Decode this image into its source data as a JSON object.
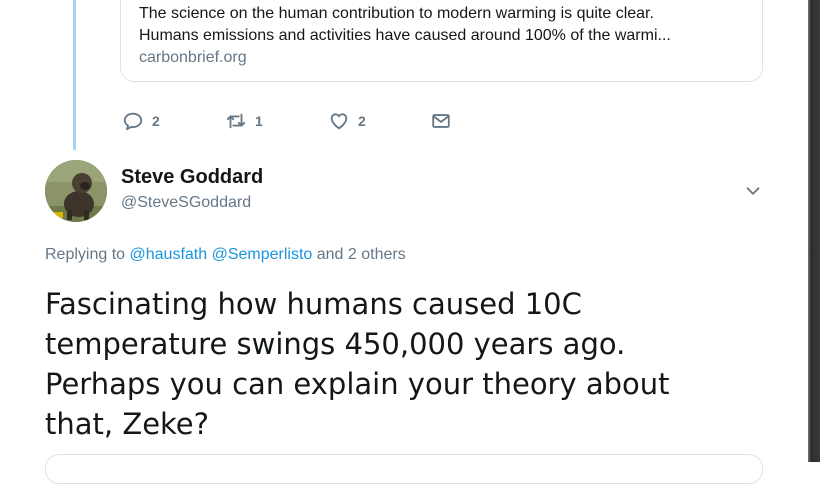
{
  "quoted_tweet": {
    "card": {
      "lines": [
        "The science on the human contribution to modern warming is quite clear.",
        "Humans emissions and activities have caused around 100% of the warmi..."
      ],
      "domain": "carbonbrief.org"
    },
    "actions": {
      "replies": "2",
      "retweets": "1",
      "likes": "2"
    }
  },
  "tweet": {
    "author": {
      "name": "Steve Goddard",
      "handle": "@SteveSGoddard"
    },
    "replying": {
      "prefix": "Replying to",
      "mention1": "@hausfath",
      "mention2": "@Semperlisto",
      "suffix": "and 2 others"
    },
    "text_lines": [
      "Fascinating how humans caused 10C",
      "temperature swings 450,000 years ago.",
      "Perhaps you can explain your theory about",
      "that, Zeke?"
    ]
  },
  "colors": {
    "thread_line": "#a8d4ef",
    "secondary_text": "#657786",
    "link": "#1b95e0",
    "primary_text": "#14171a"
  },
  "icons": [
    "reply-icon",
    "retweet-icon",
    "like-icon",
    "direct-message-icon",
    "chevron-down-icon"
  ]
}
